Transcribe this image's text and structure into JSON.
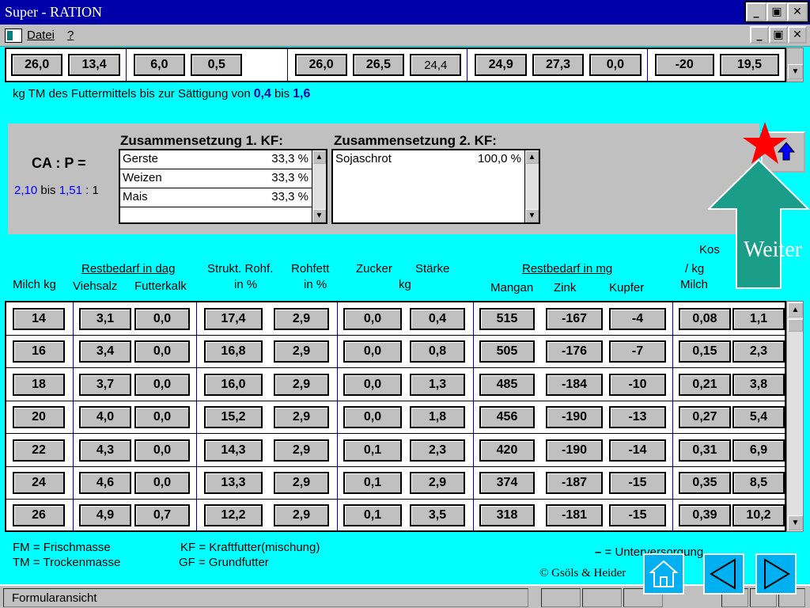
{
  "window": {
    "title": "Super - RATION"
  },
  "menu": {
    "items": [
      "Datei",
      "?"
    ]
  },
  "top_values": [
    "26,0",
    "13,4",
    "6,0",
    "0,5",
    "26,0",
    "26,5",
    "24,4",
    "24,9",
    "27,3",
    "0,0",
    "-20",
    "19,5"
  ],
  "info": {
    "text": "kg TM des Futtermittels bis zur Sättigung von",
    "from": "0,4",
    "mid": "bis",
    "to": "1,6"
  },
  "ca": {
    "label": "CA : P =",
    "low": "2,10",
    "bis": "bis",
    "high": "1,51",
    "suffix": ": 1"
  },
  "kf1": {
    "title": "Zusammensetzung 1. KF:",
    "items": [
      {
        "name": "Gerste",
        "pct": "33,3 %"
      },
      {
        "name": "Weizen",
        "pct": "33,3 %"
      },
      {
        "name": "Mais",
        "pct": "33,3 %"
      }
    ]
  },
  "kf2": {
    "title": "Zusammensetzung 2. KF:",
    "items": [
      {
        "name": "Sojaschrot",
        "pct": "100,0 %"
      }
    ]
  },
  "headers": {
    "milch": "Milch kg",
    "restbedarf_dag": "Restbedarf in dag",
    "viehsalz": "Viehsalz",
    "futterkalk": "Futterkalk",
    "strukt": "Strukt. Rohf.",
    "in_pct1": "in %",
    "rohfett": "Rohfett",
    "in_pct2": "in %",
    "zucker": "Zucker",
    "staerke": "Stärke",
    "kg": "kg",
    "restbedarf_mg": "Restbedarf in mg",
    "mangan": "Mangan",
    "zink": "Zink",
    "kupfer": "Kupfer",
    "kos": "Kos",
    "per_kg": "/ kg",
    "milch2": "Milch"
  },
  "rows": [
    [
      "14",
      "3,1",
      "0,0",
      "17,4",
      "2,9",
      "0,0",
      "0,4",
      "515",
      "-167",
      "-4",
      "0,08",
      "1,1"
    ],
    [
      "16",
      "3,4",
      "0,0",
      "16,8",
      "2,9",
      "0,0",
      "0,8",
      "505",
      "-176",
      "-7",
      "0,15",
      "2,3"
    ],
    [
      "18",
      "3,7",
      "0,0",
      "16,0",
      "2,9",
      "0,0",
      "1,3",
      "485",
      "-184",
      "-10",
      "0,21",
      "3,8"
    ],
    [
      "20",
      "4,0",
      "0,0",
      "15,2",
      "2,9",
      "0,0",
      "1,8",
      "456",
      "-190",
      "-13",
      "0,27",
      "5,4"
    ],
    [
      "22",
      "4,3",
      "0,0",
      "14,3",
      "2,9",
      "0,1",
      "2,3",
      "420",
      "-190",
      "-14",
      "0,31",
      "6,9"
    ],
    [
      "24",
      "4,6",
      "0,0",
      "13,3",
      "2,9",
      "0,1",
      "2,9",
      "374",
      "-187",
      "-15",
      "0,35",
      "8,5"
    ],
    [
      "26",
      "4,9",
      "0,7",
      "12,2",
      "2,9",
      "0,1",
      "3,5",
      "318",
      "-181",
      "-15",
      "0,39",
      "10,2"
    ]
  ],
  "legend": {
    "fm": "FM = Frischmasse",
    "tm": "TM = Trockenmasse",
    "kf": "KF = Kraftfutter(mischung)",
    "gf": "GF = Grundfutter",
    "dash": "–",
    "unter": "= Unterversorgung"
  },
  "copyright": "© Gsöls & Heider",
  "status": {
    "text": "Formularansicht"
  },
  "overlay": {
    "weiter": "Weiter"
  },
  "colors": {
    "background": "#00ffff",
    "titlebar": "#0000a8",
    "weiter_arrow": "#1a9e8a",
    "star": "#ff0000",
    "nav_button": "#00b0f0"
  },
  "icons": [
    "star-icon",
    "up-arrow-icon",
    "home-icon",
    "previous-icon",
    "next-icon"
  ]
}
